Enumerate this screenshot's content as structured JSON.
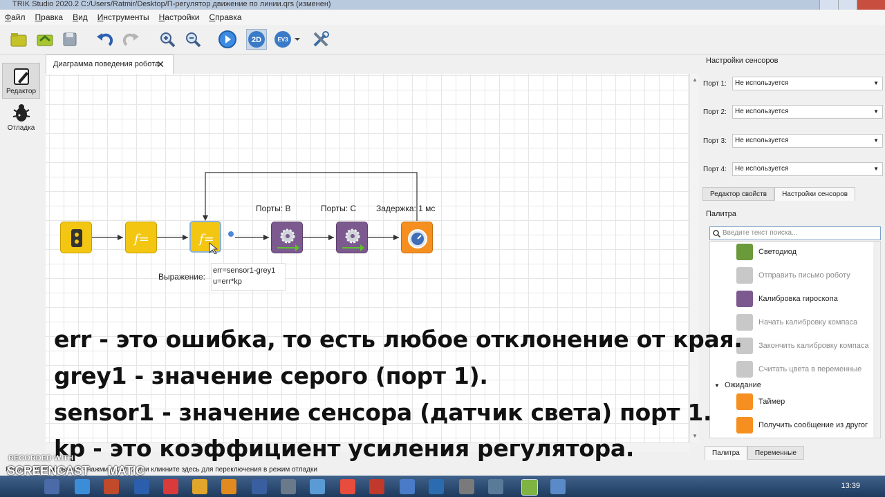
{
  "window": {
    "title": "TRIK Studio 2020.2 C:/Users/Ratmir/Desktop/П-регулятор движение по линии.qrs (изменен)"
  },
  "menu": [
    "Файл",
    "Правка",
    "Вид",
    "Инструменты",
    "Настройки",
    "Справка"
  ],
  "toolbar": {
    "icons": [
      "new-project-icon",
      "open-icon",
      "save-icon",
      "undo-icon",
      "redo-icon",
      "zoom-in-icon",
      "zoom-out-icon",
      "run-icon",
      "mode-2d-icon",
      "ev3-icon",
      "tools-icon"
    ],
    "mode_2d": "2D",
    "ev3": "EV3"
  },
  "left_sidebar": {
    "editor": "Редактор",
    "debug": "Отладка"
  },
  "document_tab": {
    "label": "Диаграмма поведения робота",
    "close": "✕"
  },
  "diagram": {
    "port_b_label": "Порты: B",
    "port_c_label": "Порты: C",
    "delay_label": "Задержка:  1  мс",
    "expression_label": "Выражение:",
    "expression_line1": "err=sensor1-grey1",
    "expression_line2": "u=err*kp"
  },
  "sensor_settings": {
    "title": "Настройки сенсоров",
    "ports": [
      {
        "label": "Порт 1:",
        "value": "Не используется"
      },
      {
        "label": "Порт 2:",
        "value": "Не используется"
      },
      {
        "label": "Порт 3:",
        "value": "Не используется"
      },
      {
        "label": "Порт 4:",
        "value": "Не используется"
      }
    ],
    "tabs": [
      "Редактор свойств",
      "Настройки сенсоров"
    ]
  },
  "palette": {
    "title": "Палитра",
    "search_placeholder": "Введите текст поиска...",
    "items": [
      {
        "label": "Светодиод",
        "enabled": true
      },
      {
        "label": "Отправить письмо роботу",
        "enabled": false
      },
      {
        "label": "Калибровка  гироскопа",
        "enabled": true
      },
      {
        "label": "Начать калибровку компаса",
        "enabled": false
      },
      {
        "label": "Закончить калибровку компаса",
        "enabled": false
      },
      {
        "label": "Считать цвета в переменные",
        "enabled": false
      }
    ],
    "group": "Ожидание",
    "group_items": [
      {
        "label": "Таймер",
        "enabled": true
      },
      {
        "label": "Получить сообщение из другог",
        "enabled": true
      }
    ],
    "bottom_tabs": [
      "Палитра",
      "Переменные"
    ]
  },
  "status_bar": {
    "text": "Режим редактирования - нажмите Ctrl+2 или кликните здесь для переключения в режим отладки"
  },
  "taskbar": {
    "clock": "13:39"
  },
  "overlay_text": [
    "err - это ошибка, то есть любое отклонение от  края.",
    "grey1 - значение серого (порт 1).",
    "sensor1 - значение сенсора (датчик света) порт 1.",
    "kp - это коэффициент усиления регулятора."
  ],
  "watermark": {
    "line1": "RECORDED WITH",
    "line2": "SCREENCAST",
    "line3": "MATIC"
  }
}
